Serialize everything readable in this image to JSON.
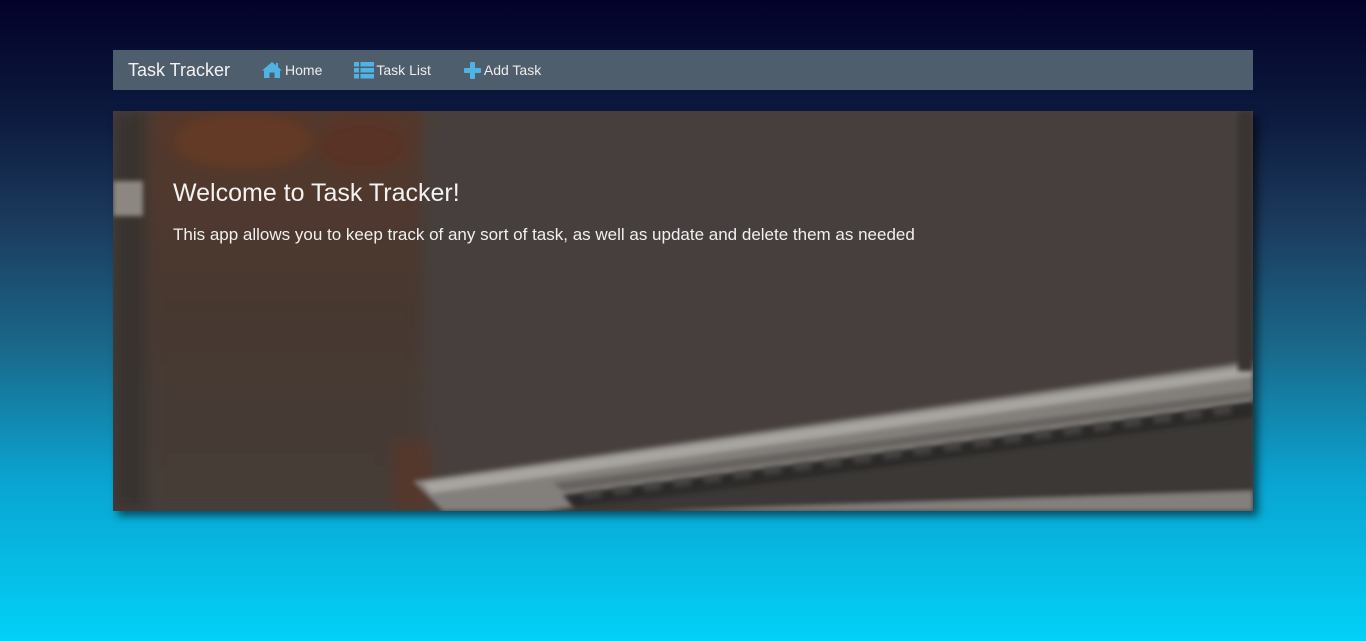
{
  "navbar": {
    "brand": "Task Tracker",
    "links": [
      {
        "label": "Home",
        "icon": "home-icon"
      },
      {
        "label": "Task List",
        "icon": "list-icon"
      },
      {
        "label": "Add Task",
        "icon": "plus-icon"
      }
    ]
  },
  "hero": {
    "title": "Welcome to Task Tracker!",
    "text": "This app allows you to keep track of any sort of task, as well as update and delete them as needed"
  },
  "colors": {
    "navbar_bg": "#4f5e6c",
    "icon_accent": "#4fb3e3",
    "hero_overlay": "#4a4341",
    "page_gradient_top": "#03012a",
    "page_gradient_bottom": "#02d1f7"
  }
}
